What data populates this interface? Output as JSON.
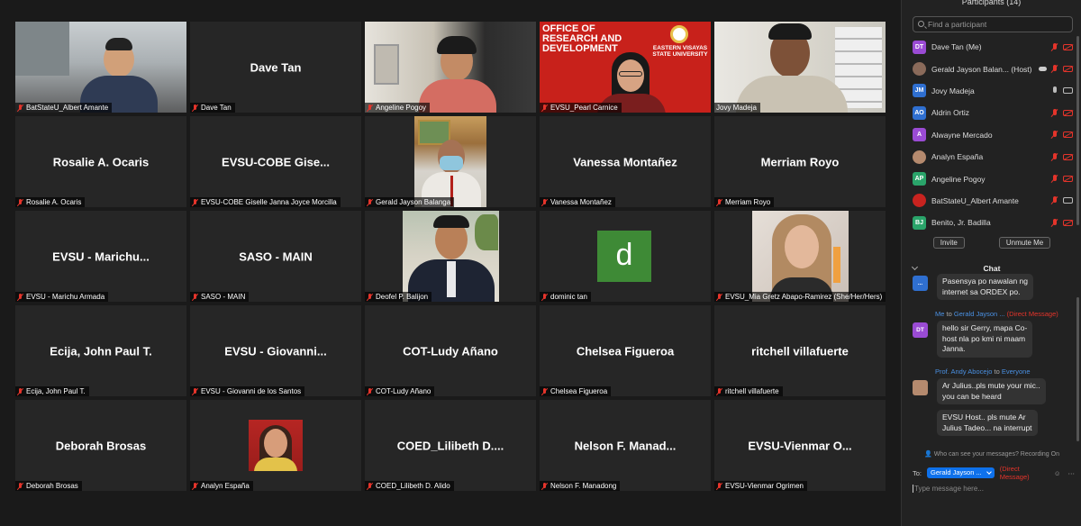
{
  "panel": {
    "title": "Participants (14)",
    "search_placeholder": "Find a participant",
    "participants": [
      {
        "initials": "DT",
        "color": "#9a4bd4",
        "name": "Dave Tan (Me)",
        "mic": "off",
        "cam": "off",
        "photo": false
      },
      {
        "initials": "",
        "color": "#8a6a5a",
        "name": "Gerald Jayson Balan... (Host)",
        "mic": "off",
        "cam": "off",
        "photo": true,
        "cloud": true
      },
      {
        "initials": "JM",
        "color": "#2f6fd0",
        "name": "Jovy Madeja",
        "mic": "on",
        "cam": "on",
        "photo": false
      },
      {
        "initials": "AO",
        "color": "#2f6fd0",
        "name": "Aldrin Ortiz",
        "mic": "off",
        "cam": "off",
        "photo": false
      },
      {
        "initials": "A",
        "color": "#9a4bd4",
        "name": "Alwayne Mercado",
        "mic": "off",
        "cam": "off",
        "photo": false
      },
      {
        "initials": "",
        "color": "#b58a6e",
        "name": "Analyn España",
        "mic": "off",
        "cam": "off",
        "photo": true
      },
      {
        "initials": "AP",
        "color": "#2aa46a",
        "name": "Angeline Pogoy",
        "mic": "off",
        "cam": "off",
        "photo": false
      },
      {
        "initials": "",
        "color": "#c8231f",
        "name": "BatStateU_Albert Amante",
        "mic": "off",
        "cam": "on",
        "photo": true
      },
      {
        "initials": "BJ",
        "color": "#2aa46a",
        "name": "Benito, Jr. Badilla",
        "mic": "off",
        "cam": "off",
        "photo": false
      }
    ],
    "invite_label": "Invite",
    "unmute_label": "Unmute Me",
    "chat_title": "Chat",
    "messages": [
      {
        "avatar": "...",
        "color": "#2f6fd0",
        "text_lines": [
          "Pasensya po nawalan ng",
          "internet sa ORDEX po."
        ]
      },
      {
        "meta_from": "Me",
        "meta_to_word": "to",
        "meta_to": "Gerald Jayson ...",
        "meta_dm": "(Direct Message)",
        "avatar": "DT",
        "color": "#9a4bd4",
        "text_lines": [
          "hello sir Gerry, mapa Co-",
          "host nla po kmi ni maam",
          "Janna."
        ]
      },
      {
        "meta_from": "Prof. Andy Abocejo",
        "meta_to_word": "to",
        "meta_to": "Everyone",
        "avatar": "",
        "color": "#b58a6e",
        "text_lines": [
          "Ar Julius..pls mute your mic..",
          "you can be heard"
        ]
      },
      {
        "text_lines": [
          "EVSU Host.. pls mute Ar",
          "Julius Tadeo... na interrupt"
        ]
      }
    ],
    "privacy_text": "Who can see your messages? Recording On",
    "to_label": "To:",
    "to_recipient": "Gerald Jayson ...",
    "to_dm": "(Direct Message)",
    "type_placeholder": "Type message here..."
  },
  "tiles": [
    {
      "type": "video",
      "scene": "office-man",
      "label": "BatStateU_Albert Amante",
      "muted": true
    },
    {
      "type": "name",
      "name": "Dave Tan",
      "label": "Dave Tan",
      "muted": true
    },
    {
      "type": "video",
      "scene": "woman-pink",
      "label": "Angeline Pogoy",
      "muted": true
    },
    {
      "type": "video",
      "scene": "research-bg",
      "label": "EVSU_Pearl Carnice",
      "muted": true,
      "bg_text_lines": [
        "OFFICE OF",
        "RESEARCH AND",
        "DEVELOPMENT"
      ],
      "bg_logo_lines": [
        "EASTERN VISAYAS",
        "STATE UNIVERSITY"
      ]
    },
    {
      "type": "video",
      "scene": "man-shelves",
      "label": "Jovy Madeja",
      "muted": false,
      "active": true
    },
    {
      "type": "name",
      "name": "Rosalie A. Ocaris",
      "label": "Rosalie A. Ocaris",
      "muted": true
    },
    {
      "type": "name",
      "name": "EVSU-COBE Gise...",
      "label": "EVSU-COBE Giselle Janna Joyce Morcilla",
      "muted": true
    },
    {
      "type": "photo",
      "scene": "man-mask",
      "label": "Gerald Jayson Balanga",
      "muted": true
    },
    {
      "type": "name",
      "name": "Vanessa Montañez",
      "label": "Vanessa Montañez",
      "muted": true
    },
    {
      "type": "name",
      "name": "Merriam Royo",
      "label": "Merriam Royo",
      "muted": true
    },
    {
      "type": "name",
      "name": "EVSU - Marichu...",
      "label": "EVSU - Marichu Armada",
      "muted": true
    },
    {
      "type": "name",
      "name": "SASO - MAIN",
      "label": "SASO - MAIN",
      "muted": true
    },
    {
      "type": "photo",
      "scene": "man-suit",
      "label": "Deofel P. Balijon",
      "muted": true
    },
    {
      "type": "letter",
      "letter": "d",
      "label": "dominic tan",
      "muted": true
    },
    {
      "type": "photo",
      "scene": "woman-blonde",
      "label": "EVSU_Mia Gretz Abapo-Ramirez (She/Her/Hers)",
      "muted": true
    },
    {
      "type": "name",
      "name": "Ecija, John Paul T.",
      "label": "Ecija, John Paul T.",
      "muted": true
    },
    {
      "type": "name",
      "name": "EVSU - Giovanni...",
      "label": "EVSU - Giovanni de los Santos",
      "muted": true
    },
    {
      "type": "name",
      "name": "COT-Ludy Añano",
      "label": "COT-Ludy Añano",
      "muted": true
    },
    {
      "type": "name",
      "name": "Chelsea Figueroa",
      "label": "Chelsea Figueroa",
      "muted": true
    },
    {
      "type": "name",
      "name": "ritchell villafuerte",
      "label": "ritchell villafuerte",
      "muted": true
    },
    {
      "type": "name",
      "name": "Deborah Brosas",
      "label": "Deborah Brosas",
      "muted": true
    },
    {
      "type": "photo",
      "scene": "woman-photo",
      "label": "Analyn España",
      "muted": true
    },
    {
      "type": "name",
      "name": "COED_Lilibeth D....",
      "label": "COED_Lilibeth D. Alido",
      "muted": true
    },
    {
      "type": "name",
      "name": "Nelson F. Manad...",
      "label": "Nelson F. Manadong",
      "muted": true
    },
    {
      "type": "name",
      "name": "EVSU-Vienmar O...",
      "label": "EVSU-Vienmar Ogrimen",
      "muted": true
    }
  ]
}
